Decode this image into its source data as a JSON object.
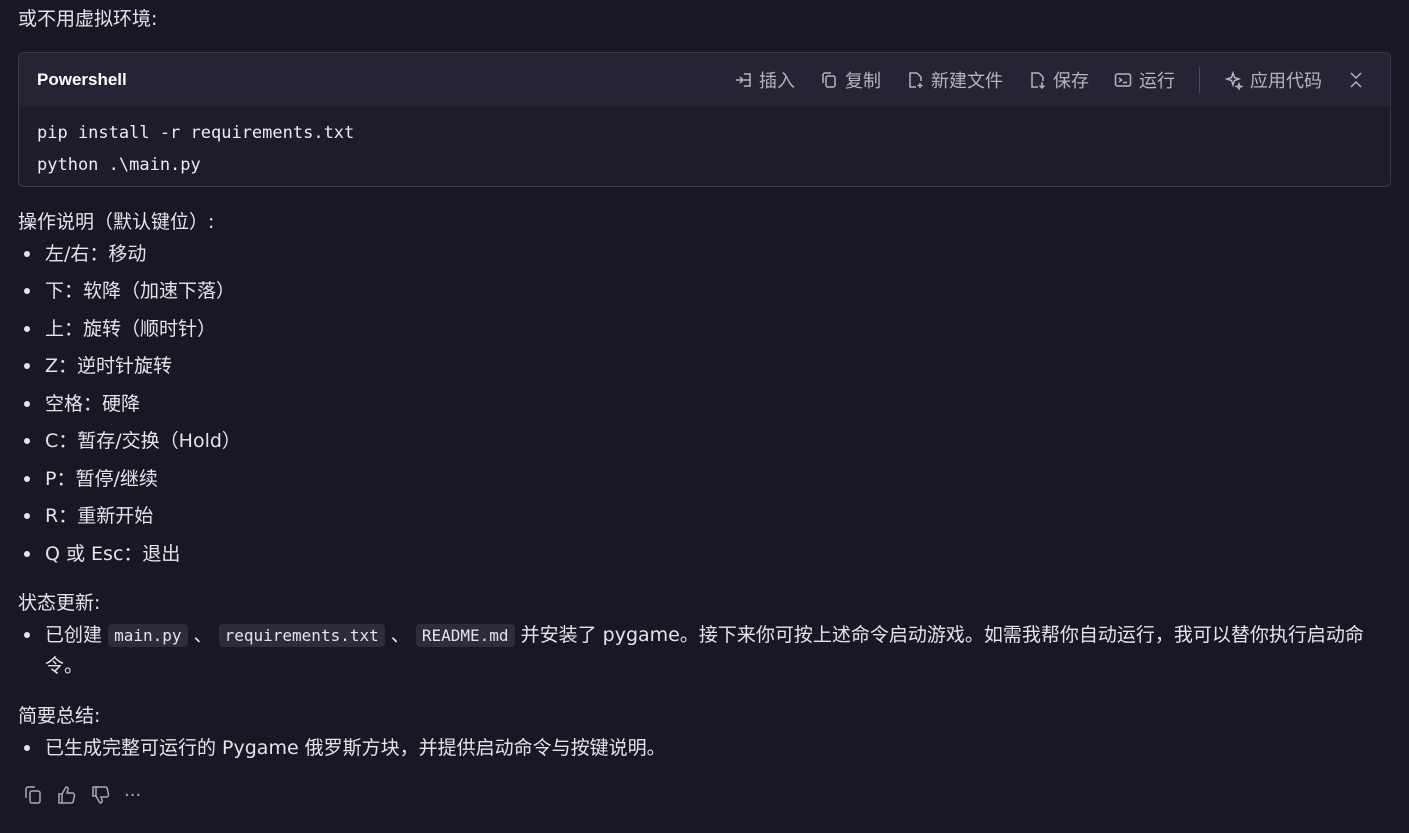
{
  "intro": "或不用虚拟环境:",
  "code_block": {
    "language": "Powershell",
    "toolbar": {
      "insert": "插入",
      "copy": "复制",
      "new_file": "新建文件",
      "save": "保存",
      "run": "运行",
      "apply_code": "应用代码"
    },
    "lines": [
      "pip install -r requirements.txt",
      "python .\\main.py"
    ]
  },
  "controls": {
    "heading": "操作说明（默认键位）:",
    "items": [
      "左/右：移动",
      "下：软降（加速下落）",
      "上：旋转（顺时针）",
      "Z：逆时针旋转",
      "空格：硬降",
      "C：暂存/交换（Hold）",
      "P：暂停/继续",
      "R：重新开始",
      "Q 或 Esc：退出"
    ]
  },
  "status": {
    "heading": "状态更新:",
    "prefix": "已创建",
    "file1": "main.py",
    "sep1": "、",
    "file2": "requirements.txt",
    "sep2": "、",
    "file3": "README.md",
    "suffix": "并安装了 pygame。接下来你可按上述命令启动游戏。如需我帮你自动运行，我可以替你执行启动命令。"
  },
  "summary": {
    "heading": "简要总结:",
    "items": [
      "已生成完整可运行的 Pygame 俄罗斯方块，并提供启动命令与按键说明。"
    ]
  },
  "actions": {
    "more": "···"
  }
}
